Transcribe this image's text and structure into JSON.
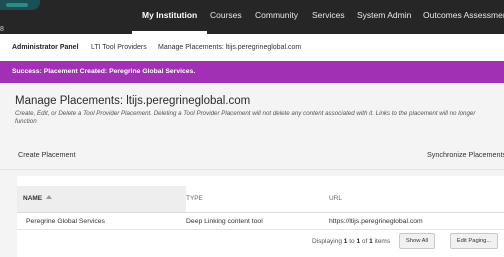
{
  "nav": {
    "items": [
      {
        "label": "My Institution",
        "active": true
      },
      {
        "label": "Courses"
      },
      {
        "label": "Community"
      },
      {
        "label": "Services"
      },
      {
        "label": "System Admin"
      },
      {
        "label": "Outcomes Assessment"
      }
    ],
    "edge_char": "8"
  },
  "breadcrumb": {
    "items": [
      "Administrator Panel",
      "LTI Tool Providers",
      "Manage Placements: ltijs.peregrineglobal.com"
    ]
  },
  "banner": {
    "text": "Success: Placement Created: Peregrine Global Services.",
    "color": "#a130b4"
  },
  "page": {
    "title": "Manage Placements: ltijs.peregrineglobal.com",
    "description": "Create, Edit, or Delete a Tool Provider Placement. Deleting a Tool Provider Placement will not delete any content associated with it. Links to the placement will no longer function"
  },
  "actions": {
    "create": "Create Placement",
    "sync": "Synchronize Placements"
  },
  "table": {
    "headers": {
      "name": "NAME",
      "type": "TYPE",
      "url": "URL"
    },
    "rows": [
      {
        "name": "Peregrine Global Services",
        "type": "Deep Linking content tool",
        "url": "https://ltijs.peregrineglobal.com"
      }
    ],
    "paging": {
      "prefix": "Displaying ",
      "from": "1",
      "to_word": " to ",
      "to": "1",
      "of_word": " of ",
      "total": "1",
      "suffix": " items"
    },
    "show_all": "Show All",
    "edit_paging": "Edit Paging..."
  }
}
